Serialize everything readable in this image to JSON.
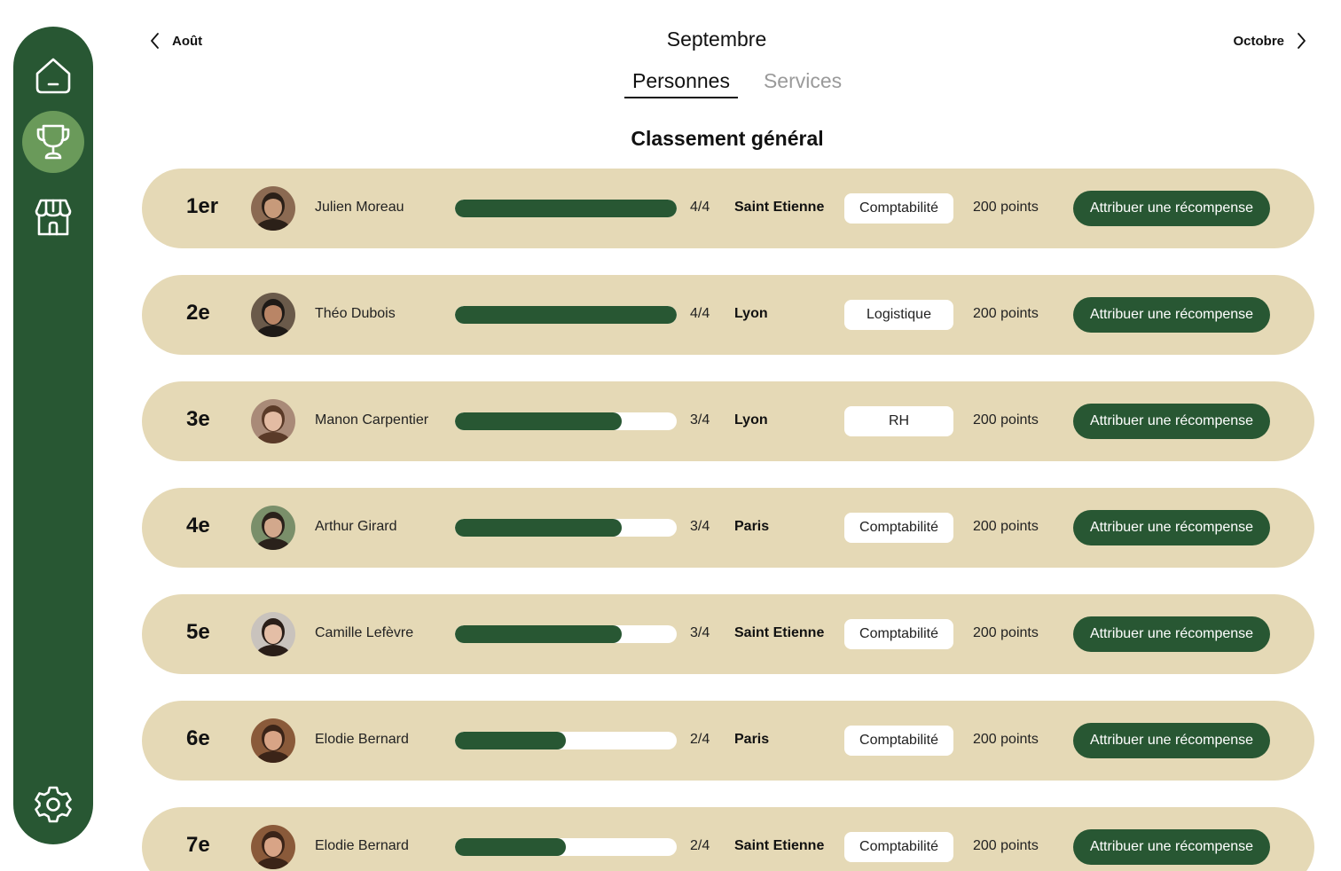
{
  "colors": {
    "sidebar": "#285733",
    "active_icon_bg": "#6a9a5a",
    "row_bg": "#e5d9b6",
    "accent": "#285733"
  },
  "sidebar": {
    "items": [
      {
        "icon": "home-icon",
        "active": false
      },
      {
        "icon": "trophy-icon",
        "active": true
      },
      {
        "icon": "store-icon",
        "active": false
      }
    ],
    "bottom_icon": "settings-icon"
  },
  "header": {
    "prev_month": "Août",
    "current_month": "Septembre",
    "next_month": "Octobre"
  },
  "tabs": [
    {
      "label": "Personnes",
      "active": true
    },
    {
      "label": "Services",
      "active": false
    }
  ],
  "section_title": "Classement général",
  "ranking": [
    {
      "rank": "1er",
      "name": "Julien Moreau",
      "progress": "4/4",
      "progress_ratio": 1.0,
      "city": "Saint Etienne",
      "department": "Comptabilité",
      "points": "200 points",
      "action": "Attribuer une récompense",
      "avatar_skin": "#c79a7a",
      "avatar_hair": "#2b2018",
      "avatar_bg": "#8b6a52"
    },
    {
      "rank": "2e",
      "name": "Théo Dubois",
      "progress": "4/4",
      "progress_ratio": 1.0,
      "city": "Lyon",
      "department": "Logistique",
      "points": "200 points",
      "action": "Attribuer une récompense",
      "avatar_skin": "#b98566",
      "avatar_hair": "#1e1a17",
      "avatar_bg": "#6a5a4a"
    },
    {
      "rank": "3e",
      "name": "Manon Carpentier",
      "progress": "3/4",
      "progress_ratio": 0.75,
      "city": "Lyon",
      "department": "RH",
      "points": "200 points",
      "action": "Attribuer une récompense",
      "avatar_skin": "#e3bba3",
      "avatar_hair": "#5a3a28",
      "avatar_bg": "#a98a78"
    },
    {
      "rank": "4e",
      "name": "Arthur Girard",
      "progress": "3/4",
      "progress_ratio": 0.75,
      "city": "Paris",
      "department": "Comptabilité",
      "points": "200 points",
      "action": "Attribuer une récompense",
      "avatar_skin": "#d2a88c",
      "avatar_hair": "#2a211b",
      "avatar_bg": "#7a8f6a"
    },
    {
      "rank": "5e",
      "name": "Camille Lefèvre",
      "progress": "3/4",
      "progress_ratio": 0.75,
      "city": "Saint Etienne",
      "department": "Comptabilité",
      "points": "200 points",
      "action": "Attribuer une récompense",
      "avatar_skin": "#e4bea6",
      "avatar_hair": "#2a1e18",
      "avatar_bg": "#c9c3bd"
    },
    {
      "rank": "6e",
      "name": "Elodie Bernard",
      "progress": "2/4",
      "progress_ratio": 0.5,
      "city": "Paris",
      "department": "Comptabilité",
      "points": "200 points",
      "action": "Attribuer une récompense",
      "avatar_skin": "#d8a486",
      "avatar_hair": "#3b2418",
      "avatar_bg": "#8a5a3a"
    },
    {
      "rank": "7e",
      "name": "Elodie Bernard",
      "progress": "2/4",
      "progress_ratio": 0.5,
      "city": "Saint Etienne",
      "department": "Comptabilité",
      "points": "200 points",
      "action": "Attribuer une récompense",
      "avatar_skin": "#d8a486",
      "avatar_hair": "#3b2418",
      "avatar_bg": "#8a5a3a"
    }
  ]
}
